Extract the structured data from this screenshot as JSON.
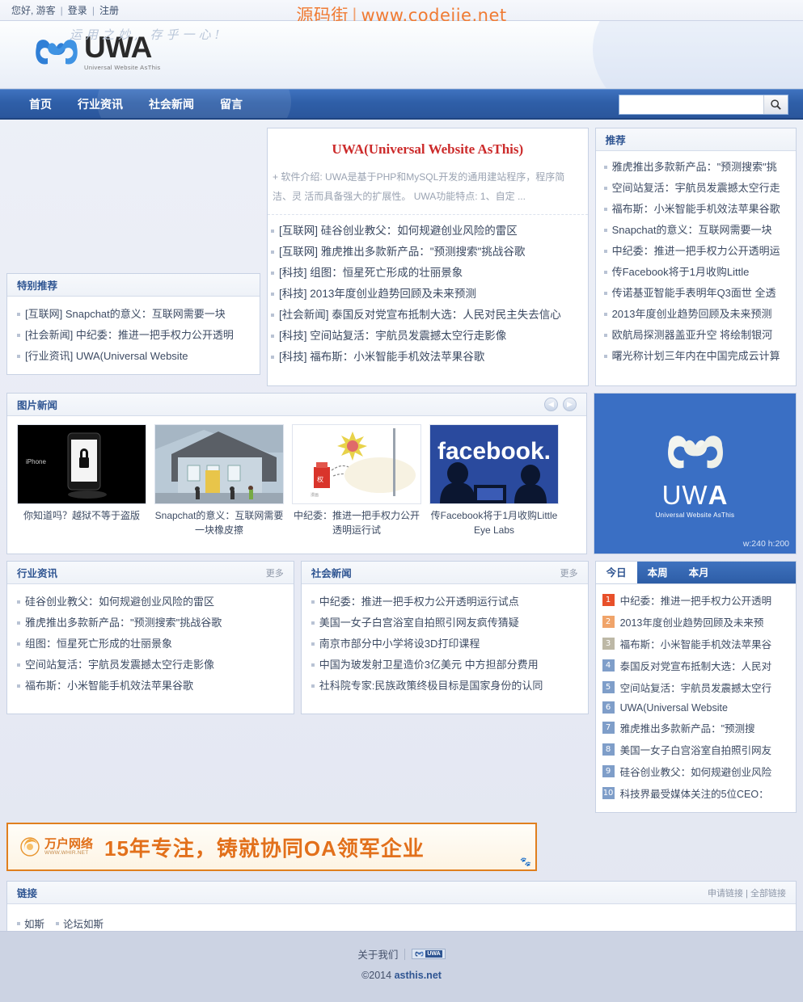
{
  "topbar": {
    "greeting": "您好, 游客",
    "login": "登录",
    "register": "注册",
    "separator": "|"
  },
  "watermark": {
    "left": "源码街",
    "bar": "|",
    "right": "www.codejie.net"
  },
  "header": {
    "logo_text": "UWA",
    "logo_sub": "Universal Website AsThis",
    "slogan": "运用之妙, 存乎一心!"
  },
  "nav": {
    "items": [
      {
        "label": "首页"
      },
      {
        "label": "行业资讯"
      },
      {
        "label": "社会新闻"
      },
      {
        "label": "留言"
      }
    ]
  },
  "search": {
    "value": "",
    "placeholder": "",
    "icon": "search-icon"
  },
  "special_recommend": {
    "title": "特别推荐",
    "items": [
      "[互联网] Snapchat的意义：互联网需要一块",
      "[社会新闻] 中纪委：推进一把手权力公开透明",
      "[行业资讯] UWA(Universal Website"
    ]
  },
  "feature": {
    "title": "UWA(Universal Website AsThis)",
    "intro": "+ 软件介绍: UWA是基于PHP和MySQL开发的通用建站程序，程序简洁、灵 活而具备强大的扩展性。 UWA功能特点: 1、自定 ...",
    "items": [
      "[互联网] 硅谷创业教父：如何规避创业风险的雷区",
      "[互联网] 雅虎推出多款新产品：\"预测搜索\"挑战谷歌",
      "[科技] 组图：恒星死亡形成的壮丽景象",
      "[科技] 2013年度创业趋势回顾及未来预测",
      "[社会新闻] 泰国反对党宣布抵制大选：人民对民主失去信心",
      "[科技] 空间站复活：宇航员发震撼太空行走影像",
      "[科技] 福布斯：小米智能手机效法苹果谷歌"
    ]
  },
  "recommend": {
    "title": "推荐",
    "items": [
      "雅虎推出多款新产品：\"预测搜索\"挑",
      "空间站复活：宇航员发震撼太空行走",
      "福布斯：小米智能手机效法苹果谷歌",
      "Snapchat的意义：互联网需要一块",
      "中纪委：推进一把手权力公开透明运",
      "传Facebook将于1月收购Little",
      "传诺基亚智能手表明年Q3面世 全透",
      "2013年度创业趋势回顾及未来预测",
      "欧航局探测器盖亚升空 将绘制银河",
      "曙光称计划三年内在中国完成云计算"
    ]
  },
  "picture_news": {
    "title": "图片新闻",
    "prev_icon": "chevron-left-icon",
    "next_icon": "chevron-right-icon",
    "items": [
      {
        "caption": "你知道吗？越狱不等于盗版",
        "image": "iphone-jailbreak-thumbnail"
      },
      {
        "caption": "Snapchat的意义：互联网需要一块橡皮擦",
        "image": "house-street-thumbnail"
      },
      {
        "caption": "中纪委：推进一把手权力公开透明运行试",
        "image": "cartoon-seal-thumbnail"
      },
      {
        "caption": "传Facebook将于1月收购Little Eye Labs",
        "image": "facebook-logo-thumbnail"
      }
    ]
  },
  "ad_box": {
    "logo_text": "UWA",
    "logo_sub": "Universal Website AsThis",
    "size_label": "w:240 h:200"
  },
  "industry_news": {
    "title": "行业资讯",
    "more": "更多",
    "items": [
      "硅谷创业教父：如何规避创业风险的雷区",
      "雅虎推出多款新产品：\"预测搜索\"挑战谷歌",
      "组图：恒星死亡形成的壮丽景象",
      "空间站复活：宇航员发震撼太空行走影像",
      "福布斯：小米智能手机效法苹果谷歌"
    ]
  },
  "social_news": {
    "title": "社会新闻",
    "more": "更多",
    "items": [
      "中纪委：推进一把手权力公开透明运行试点",
      "美国一女子白宫浴室自拍照引网友疯传猜疑",
      "南京市部分中小学将设3D打印课程",
      "中国为玻发射卫星造价3亿美元 中方担部分费用",
      "社科院专家:民族政策终极目标是国家身份的认同"
    ]
  },
  "hot": {
    "tabs": [
      {
        "label": "今日",
        "active": true
      },
      {
        "label": "本周",
        "active": false
      },
      {
        "label": "本月",
        "active": false
      }
    ],
    "items": [
      {
        "rank": "1",
        "title": "中纪委：推进一把手权力公开透明"
      },
      {
        "rank": "2",
        "title": "2013年度创业趋势回顾及未来预"
      },
      {
        "rank": "3",
        "title": "福布斯：小米智能手机效法苹果谷"
      },
      {
        "rank": "4",
        "title": "泰国反对党宣布抵制大选：人民对"
      },
      {
        "rank": "5",
        "title": "空间站复活：宇航员发震撼太空行"
      },
      {
        "rank": "6",
        "title": "UWA(Universal Website"
      },
      {
        "rank": "7",
        "title": "雅虎推出多款新产品：\"预测搜"
      },
      {
        "rank": "8",
        "title": "美国一女子白宫浴室自拍照引网友"
      },
      {
        "rank": "9",
        "title": "硅谷创业教父：如何规避创业风险"
      },
      {
        "rank": "10",
        "title": "科技界最受媒体关注的5位CEO："
      }
    ]
  },
  "banner_ad": {
    "brand_cn": "万户网络",
    "brand_en": "WWW.WHIR.NET",
    "slogan": "15年专注，铸就协同OA领军企业",
    "corner_icon": "paw-icon"
  },
  "links": {
    "title": "链接",
    "apply": "申请链接",
    "separator": "|",
    "all": "全部链接",
    "items": [
      "如斯",
      "论坛如斯"
    ]
  },
  "footer": {
    "about": "关于我们",
    "badge_text": "UWA",
    "copyright_prefix": "©2014",
    "copyright_site": "asthis.net"
  },
  "colors": {
    "nav_blue": "#2f5fa8",
    "accent_red": "#cc2b2b",
    "ad_blue": "#3a6fc4",
    "banner_orange": "#e2701b",
    "watermark_orange": "#f07a32"
  }
}
